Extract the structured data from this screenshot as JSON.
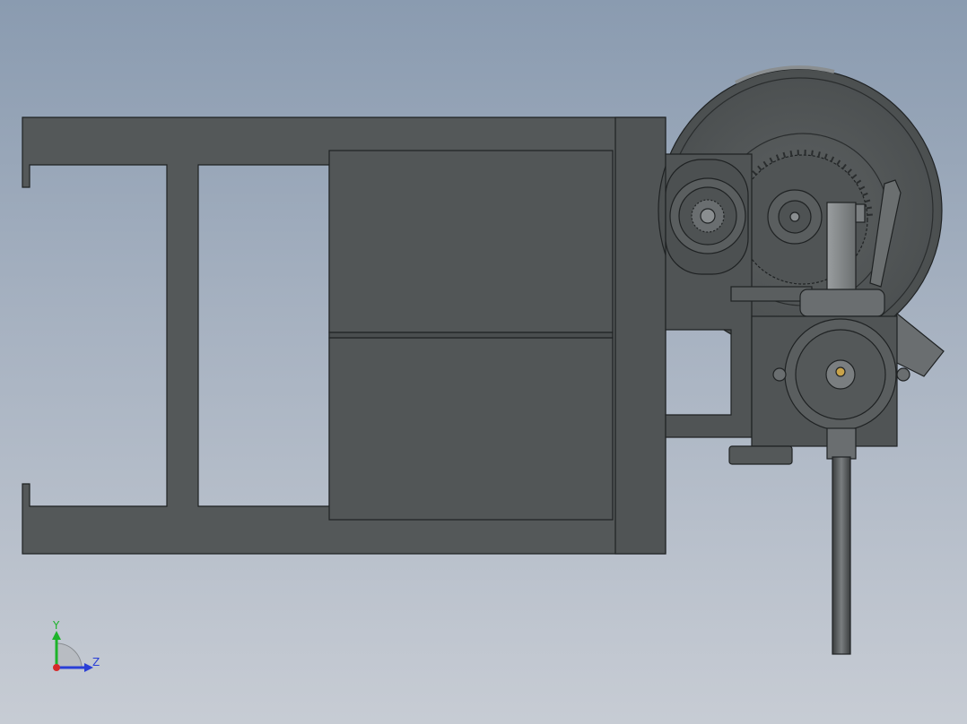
{
  "viewport": {
    "background_top": "#8a9bb0",
    "background_bottom": "#c7ccd4",
    "model_color": "#545859",
    "edge_color": "#1f2223"
  },
  "triad": {
    "y_label": "Y",
    "z_label": "Z",
    "y_color": "#1db32a",
    "z_color": "#2a3fd6",
    "x_color": "#d62a2a"
  }
}
